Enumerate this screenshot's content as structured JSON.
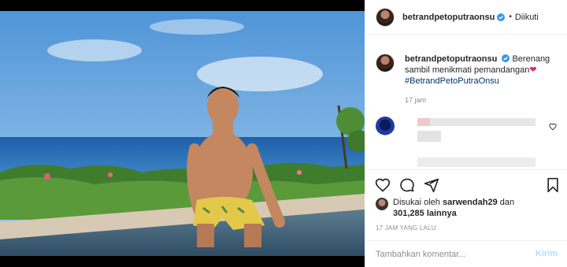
{
  "post": {
    "username": "betrandpetoputraonsu",
    "follow_status": "Diikuti",
    "dot": "•",
    "caption_username": "betrandpetoputraonsu",
    "caption_text": "Berenang sambil menikmati pemandangan",
    "caption_emoji": "❤",
    "hashtag": "#BetrandPetoPutraOnsu",
    "caption_time": "17 jam",
    "likes_prefix": "Disukai oleh",
    "liked_by": "sarwendah29",
    "likes_and": "dan",
    "likes_count": "301,285",
    "likes_suffix": "lainnya",
    "post_time": "17 JAM YANG LALU",
    "comment_placeholder": "Tambahkan komentar...",
    "post_button": "Kirim"
  },
  "icons": {
    "verified": "verified-badge-icon",
    "like": "heart-icon",
    "comment": "comment-icon",
    "share": "paper-plane-icon",
    "save": "bookmark-icon"
  },
  "colors": {
    "verified": "#3897f0",
    "hashtag": "#00376b",
    "heart_emoji": "#e0245e",
    "post_button_disabled": "#b2dffc"
  }
}
